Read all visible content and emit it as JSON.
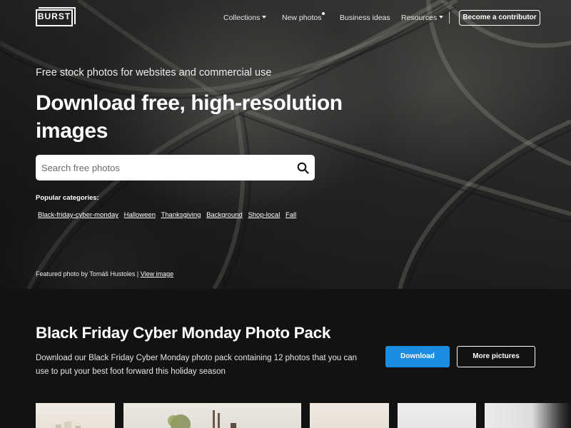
{
  "brand": {
    "logo_text": "BURST"
  },
  "nav": {
    "items": [
      {
        "label": "Collections",
        "has_caret": true
      },
      {
        "label": "New photos",
        "has_dot": true
      },
      {
        "label": "Business ideas"
      },
      {
        "label": "Resources",
        "has_caret": true
      }
    ],
    "cta_label": "Become a contributor"
  },
  "hero": {
    "tagline": "Free stock photos for websites and commercial use",
    "headline": "Download free, high-resolution images",
    "search": {
      "placeholder": "Search free photos",
      "value": "",
      "icon": "search-icon"
    },
    "popular_label": "Popular categories:",
    "categories": [
      "Black-friday-cyber-monday",
      "Halloween",
      "Thanksgiving",
      "Background",
      "Shop-local",
      "Fall"
    ],
    "featured_prefix": "Featured photo by Tomáš Hustoles | ",
    "featured_link": "View image"
  },
  "pack": {
    "title": "Black Friday Cyber Monday Photo Pack",
    "description": "Download our Black Friday Cyber Monday photo pack containing 12 photos that you can use to put your best foot forward this holiday season",
    "download_label": "Download",
    "more_label": "More pictures"
  },
  "colors": {
    "accent": "#1a8de0",
    "background": "#121212"
  }
}
